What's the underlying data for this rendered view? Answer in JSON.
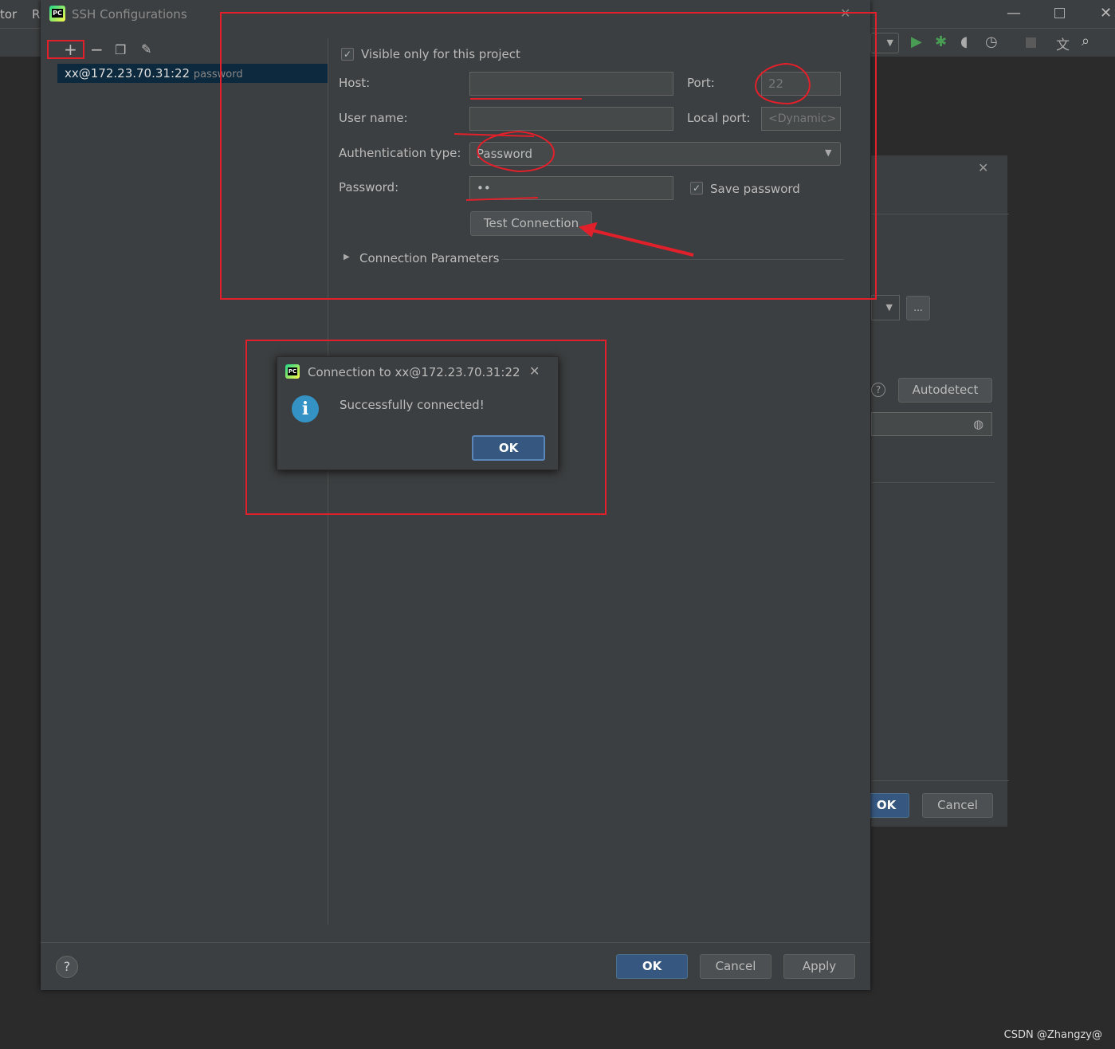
{
  "ide": {
    "menu_items": [
      "tor",
      "R"
    ],
    "watermark": "CSDN @Zhangzy@"
  },
  "dialog": {
    "title": "SSH Configurations",
    "list": [
      {
        "name": "xx@172.23.70.31:22",
        "type": "password"
      }
    ],
    "visible_only_label": "Visible only for this project",
    "visible_only_checked": true,
    "host_label": "Host:",
    "host_value": "",
    "port_label": "Port:",
    "port_value": "22",
    "username_label": "User name:",
    "username_value": "",
    "local_port_label": "Local port:",
    "local_port_placeholder": "<Dynamic>",
    "auth_label": "Authentication type:",
    "auth_value": "Password",
    "password_label": "Password:",
    "password_value": "••",
    "save_password_label": "Save password",
    "save_password_checked": true,
    "test_connection_label": "Test Connection",
    "connection_params_label": "Connection Parameters",
    "ok_label": "OK",
    "cancel_label": "Cancel",
    "apply_label": "Apply"
  },
  "bg_dialog": {
    "autodetect_label": "Autodetect",
    "ok_label": "OK",
    "cancel_label": "Cancel",
    "browse_label": "..."
  },
  "popup": {
    "title": "Connection to xx@172.23.70.31:22",
    "message": "Successfully connected!",
    "ok_label": "OK"
  },
  "colors": {
    "annotation": "#e0202a",
    "accent": "#365880",
    "run_green": "#499c54"
  }
}
